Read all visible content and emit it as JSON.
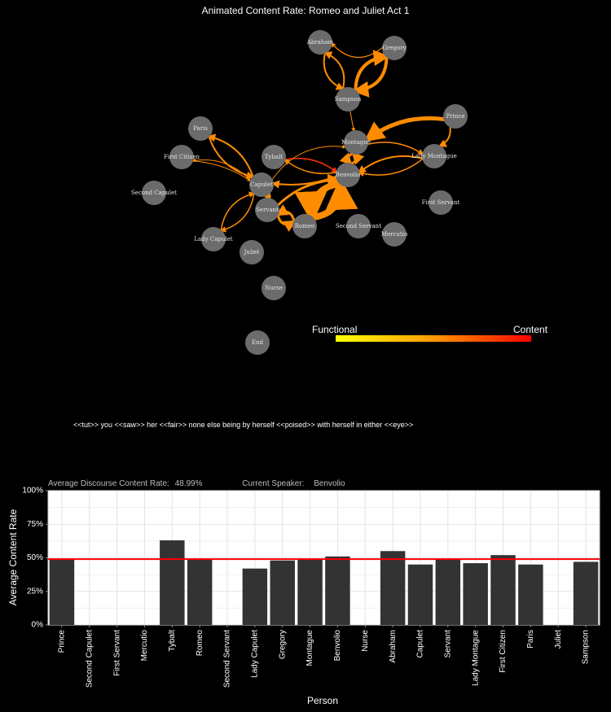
{
  "network": {
    "title": "Animated Content Rate: Romeo and Juliet Act 1",
    "nodes": [
      "Abraham",
      "Gregory",
      "Sampson",
      "Prince",
      "Paris",
      "Montague",
      "Lady Montague",
      "First Citizen",
      "Tybalt",
      "Benvolio",
      "Capulet",
      "Second Capulet",
      "First Servant",
      "Servant",
      "Romeo",
      "Second Servant",
      "Mercutio",
      "Lady Capulet",
      "Juliet",
      "Nurse",
      "End"
    ],
    "edge_color": "#ff8c00"
  },
  "legend": {
    "left_label": "Functional",
    "right_label": "Content"
  },
  "current_text": "<<tut>> you <<saw>> her <<fair>> none else being by herself <<poised>> with herself in either <<eye>>",
  "stats": {
    "avg_label": "Average Discourse Content Rate:",
    "avg_value": "48.99%",
    "speaker_label": "Current Speaker:",
    "speaker_value": "Benvolio"
  },
  "chart_data": {
    "type": "bar",
    "categories": [
      "Prince",
      "Second Capulet",
      "First Servant",
      "Mercutio",
      "Tybalt",
      "Romeo",
      "Second Servant",
      "Lady Capulet",
      "Gregory",
      "Montague",
      "Benvolio",
      "Nurse",
      "Abraham",
      "Capulet",
      "Servant",
      "Lady Montague",
      "First Citizen",
      "Paris",
      "Juliet",
      "Sampson"
    ],
    "values": [
      49,
      0,
      0,
      0,
      63,
      49,
      0,
      42,
      48,
      49,
      51,
      0,
      55,
      45,
      49,
      46,
      52,
      45,
      0,
      47
    ],
    "ylabel": "Average Content Rate",
    "xlabel": "Person",
    "yticks": [
      "0%",
      "25%",
      "50%",
      "75%",
      "100%"
    ],
    "ylim": [
      0,
      100
    ],
    "reference_line": 48.99,
    "bar_color": "#333333",
    "line_color": "#ff0000",
    "grid": true
  }
}
